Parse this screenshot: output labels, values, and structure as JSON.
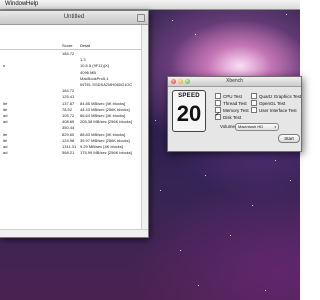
{
  "menubar": {
    "items": [
      "Window",
      "Help"
    ]
  },
  "document_window": {
    "title": "Untitled",
    "columns": [
      "Score",
      "Detail"
    ],
    "rows": [
      {
        "label": "",
        "score": "184.72",
        "detail": ""
      },
      {
        "label": "",
        "score": "",
        "detail": "1.3"
      },
      {
        "label": "n",
        "score": "",
        "detail": "10.5.5 (9F11)(X)"
      },
      {
        "label": "",
        "score": "",
        "detail": "4096 MB"
      },
      {
        "label": "",
        "score": "",
        "detail": "MacBookPro5,1"
      },
      {
        "label": "",
        "score": "",
        "detail": "INTEL SSDSA2MH080G1GC"
      },
      {
        "label": "",
        "score": "184.72",
        "detail": ""
      },
      {
        "label": "",
        "score": "125.41",
        "detail": ""
      },
      {
        "label": "ite",
        "score": "137.87",
        "detail": "84.85 MB/sec [4K blocks]"
      },
      {
        "label": "ite",
        "score": "78.52",
        "detail": "44.43 MB/sec [256K blocks]"
      },
      {
        "label": "ad",
        "score": "105.72",
        "detail": "66.64 MB/sec [4K blocks]"
      },
      {
        "label": "ad",
        "score": "408.65",
        "detail": "205.38 MB/sec [256K blocks]"
      },
      {
        "label": "",
        "score": "350.44",
        "detail": ""
      },
      {
        "label": "ite",
        "score": "829.60",
        "detail": "88.83 MB/sec [4K blocks]"
      },
      {
        "label": "ite",
        "score": "124.98",
        "detail": "39.97 MB/sec [256K blocks]"
      },
      {
        "label": "ad",
        "score": "1311.31",
        "detail": "9.29 MB/sec [4K blocks]"
      },
      {
        "label": "ad",
        "score": "568.21",
        "detail": "175.99 MB/sec [256K blocks]"
      }
    ]
  },
  "xbench": {
    "title": "Xbench",
    "badge_label": "SPEED",
    "badge_number": "20",
    "tests_left": [
      {
        "label": "CPU Test",
        "checked": false
      },
      {
        "label": "Thread Test",
        "checked": false
      },
      {
        "label": "Memory Test",
        "checked": false
      },
      {
        "label": "Disk Test",
        "checked": true
      }
    ],
    "tests_right": [
      {
        "label": "Quartz Graphics Test",
        "checked": false
      },
      {
        "label": "OpenGL Test",
        "checked": false
      },
      {
        "label": "User Interface Test",
        "checked": false
      }
    ],
    "volume_label": "Volume:",
    "volume_value": "Macintosh HD",
    "start_label": "Start"
  }
}
